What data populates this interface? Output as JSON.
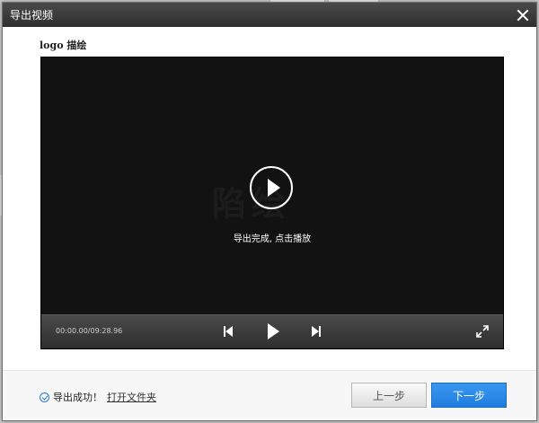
{
  "dialog": {
    "title": "导出视频",
    "close_icon": "close-icon"
  },
  "section": {
    "label": "logo 描绘"
  },
  "player": {
    "watermark": "陷绘",
    "play_icon": "play-circle-icon",
    "message": "导出完成, 点击播放",
    "time": "00:00.00/09:28.96",
    "icons": [
      "skip-back-icon",
      "play-icon",
      "skip-forward-icon",
      "fullscreen-icon"
    ]
  },
  "footer": {
    "status": "导出成功！",
    "status_icon": "check-circle-icon",
    "open_folder": "打开文件夹",
    "prev_button": "上一步",
    "next_button": "下一步"
  },
  "colors": {
    "titlebar": "#3a3a3a",
    "accent": "#2b78d6",
    "player_bg": "#121212"
  }
}
